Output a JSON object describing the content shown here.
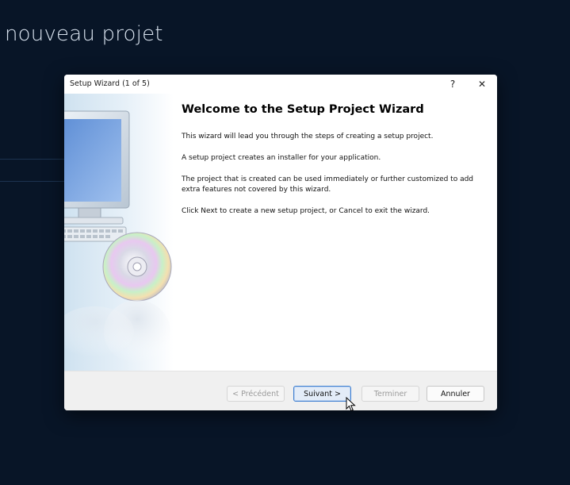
{
  "background": {
    "title": "nouveau projet"
  },
  "dialog": {
    "title": "Setup Wizard (1 of 5)",
    "help_label": "?",
    "close_label": "✕",
    "heading": "Welcome to the Setup Project Wizard",
    "paragraphs": [
      "This wizard will lead you through the steps of creating a setup project.",
      "A setup project creates an installer for your application.",
      "The project that is created can be used immediately or further customized to add extra features not covered by this wizard.",
      "Click Next to create a new setup project, or Cancel to exit the wizard."
    ],
    "buttons": {
      "previous": "< Précédent",
      "next": "Suivant >",
      "finish": "Terminer",
      "cancel": "Annuler"
    },
    "side_image": "computer-and-cd-illustration"
  },
  "colors": {
    "page_bg": "#081527",
    "accent": "#3f7fd1"
  }
}
